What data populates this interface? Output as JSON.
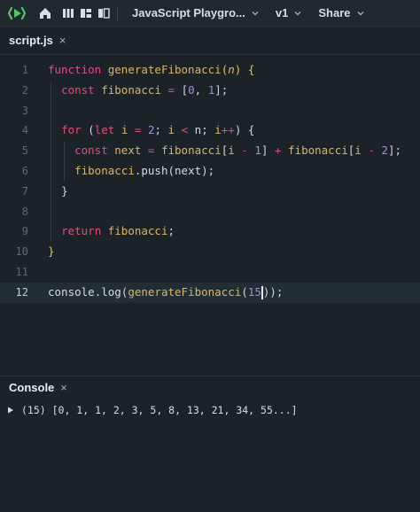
{
  "toolbar": {
    "project_name": "JavaScript Playgro...",
    "version": "v1",
    "share": "Share"
  },
  "tab": {
    "filename": "script.js",
    "close": "×"
  },
  "editor": {
    "line_numbers": [
      "1",
      "2",
      "3",
      "4",
      "5",
      "6",
      "7",
      "8",
      "9",
      "10",
      "11",
      "12"
    ],
    "active_line": 12
  },
  "console": {
    "title": "Console",
    "close": "×",
    "output": "(15) [0, 1, 1, 2, 3, 5, 8, 13, 21, 34, 55...]"
  },
  "colors": {
    "background": "#1b2329",
    "keyword": "#e04f7a",
    "function": "#d9b56a",
    "number": "#a98bd9",
    "logo": "#56c16a"
  }
}
